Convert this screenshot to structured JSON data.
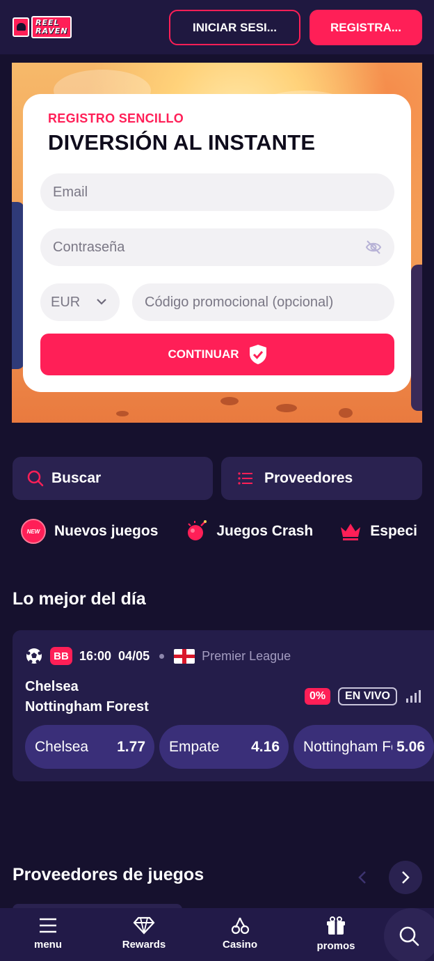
{
  "header": {
    "logo_line1": "REEL",
    "logo_line2": "RAVEN",
    "login_label": "INICIAR SESI...",
    "register_label": "REGISTRA..."
  },
  "signup": {
    "eyebrow": "REGISTRO SENCILLO",
    "title": "DIVERSIÓN AL INSTANTE",
    "email_placeholder": "Email",
    "password_placeholder": "Contraseña",
    "currency_value": "EUR",
    "promo_placeholder": "Código promocional (opcional)",
    "continue_label": "CONTINUAR"
  },
  "tools": {
    "search_label": "Buscar",
    "providers_label": "Proveedores"
  },
  "categories": [
    {
      "label": "Nuevos juegos",
      "badge": "NEW",
      "icon": "new-badge-icon"
    },
    {
      "label": "Juegos Crash",
      "icon": "crash-bomb-icon"
    },
    {
      "label": "Especi",
      "icon": "crown-icon"
    }
  ],
  "best_of_day": {
    "title": "Lo mejor del día",
    "event": {
      "sport_icon": "soccer-ball-icon",
      "badge": "BB",
      "time": "16:00",
      "date": "04/05",
      "league": "Premier League",
      "team1": "Chelsea",
      "team2": "Nottingham Forest",
      "percent_badge": "0%",
      "live_label": "EN VIVO",
      "odds": [
        {
          "name": "Chelsea",
          "value": "1.77"
        },
        {
          "name": "Empate",
          "value": "4.16"
        },
        {
          "name": "Nottingham Forest",
          "value": "5.06"
        }
      ]
    }
  },
  "providers_section": {
    "title": "Proveedores de juegos"
  },
  "bottom_nav": {
    "menu": "menu",
    "rewards": "Rewards",
    "casino": "Casino",
    "promos": "promos"
  },
  "colors": {
    "accent": "#ff1f57",
    "background": "#16112e",
    "panel": "#241d4a",
    "odds_pill": "#3a2f79"
  }
}
